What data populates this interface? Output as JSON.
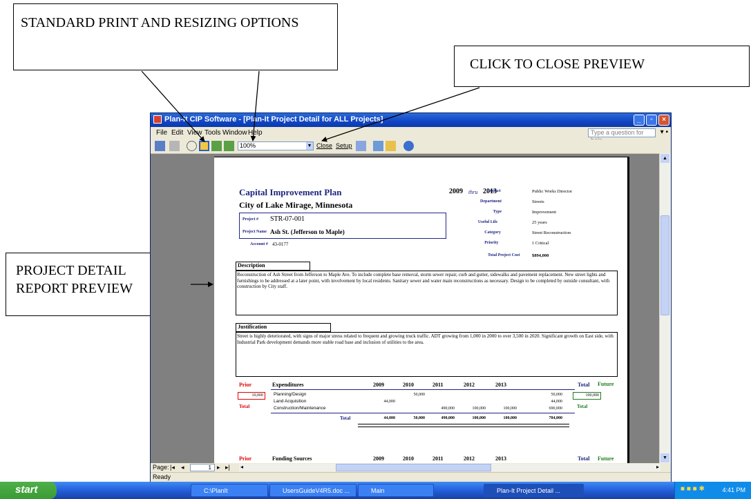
{
  "callouts": {
    "print_options": "STANDARD PRINT AND RESIZING OPTIONS",
    "close_preview": "CLICK TO CLOSE PREVIEW",
    "report_preview": "PROJECT DETAIL REPORT PREVIEW"
  },
  "window": {
    "title": "Plan-It CIP Software - [Plan-It Project Detail for ALL Projects]",
    "menu": [
      "File",
      "Edit",
      "View",
      "Tools",
      "Window",
      "Help"
    ],
    "help_placeholder": "Type a question for help",
    "zoom": "100%",
    "close_label": "Close",
    "setup_label": "Setup",
    "page_label": "Page:",
    "page_number": "1",
    "status": "Ready"
  },
  "report": {
    "title": "Capital Improvement Plan",
    "city": "City of Lake Mirage, Minnesota",
    "years": {
      "start": "2009",
      "thru": "thru",
      "end": "2013"
    },
    "project_label": "Project #",
    "project_number": "STR-07-001",
    "project_name_label": "Project Name",
    "project_name": "Ash St. (Jefferson to Maple)",
    "account_label": "Account #",
    "account": "43-0177",
    "fields": [
      {
        "label": "Contact",
        "value": "Public Works Director"
      },
      {
        "label": "Department",
        "value": "Streets"
      },
      {
        "label": "Type",
        "value": "Improvement"
      },
      {
        "label": "Useful Life",
        "value": "25 years"
      },
      {
        "label": "Category",
        "value": "Street Reconstruction"
      },
      {
        "label": "Priority",
        "value": "1 Critical"
      }
    ],
    "total_cost_label": "Total Project Cost",
    "total_cost": "$894,000",
    "description_label": "Description",
    "description": "Reconstruction of Ash Street from Jefferson to Maple Ave.  To include complete base removal, storm sewer repair, curb and gutter, sidewalks and pavement replacement.  New street lights and furnishings to be addressed at a later point, with involvement by local residents.  Sanitary sewer and water main reconstructions as necessary.  Design to be completed by outside consultant, with construction by City staff.",
    "justification_label": "Justification",
    "justification": "Street is highly deteriorated, with signs of major stress related to frequent and growing truck traffic.  ADT growing from 1,000 in 2000 to over 3,500 in 2020.  Significant growth on East side, with Industrial Park development demands more stable road base and inclusion of utilities to the area.",
    "expenditures": {
      "prior_label": "Prior",
      "heading": "Expenditures",
      "years": [
        "2009",
        "2010",
        "2011",
        "2012",
        "2013"
      ],
      "total_label": "Total",
      "future_label": "Future",
      "prior_value": "10,000",
      "prior_total_label": "Total",
      "future_value": "100,000",
      "future_total_label": "Total",
      "rows": [
        {
          "name": "Planning/Design",
          "values": [
            "",
            "50,000",
            "",
            "",
            ""
          ],
          "total": "50,000"
        },
        {
          "name": "Land Acquisition",
          "values": [
            "44,000",
            "",
            "",
            "",
            ""
          ],
          "total": "44,000"
        },
        {
          "name": "Construction/Maintenance",
          "values": [
            "",
            "",
            "490,000",
            "100,000",
            "100,000"
          ],
          "total": "690,000"
        }
      ],
      "totals": {
        "label": "Total",
        "values": [
          "44,000",
          "50,000",
          "490,000",
          "100,000",
          "100,000"
        ],
        "total": "784,000"
      }
    },
    "funding": {
      "prior_label": "Prior",
      "heading": "Funding Sources",
      "years": [
        "2009",
        "2010",
        "2011",
        "2012",
        "2013"
      ],
      "total_label": "Total",
      "future_label": "Future"
    }
  },
  "taskbar": {
    "start": "start",
    "tasks": [
      "C:\\PlanIt",
      "UsersGuideV4R5.doc ...",
      "Main",
      "Plan-It Project Detail ..."
    ],
    "time": "4:41 PM"
  }
}
